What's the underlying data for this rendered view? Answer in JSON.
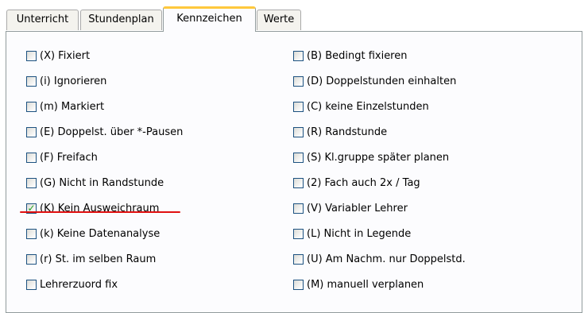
{
  "tabs": [
    {
      "label": "Unterricht",
      "active": false
    },
    {
      "label": "Stundenplan",
      "active": false
    },
    {
      "label": "Kennzeichen",
      "active": true
    },
    {
      "label": "Werte",
      "active": false
    }
  ],
  "left_options": [
    {
      "label": "(X) Fixiert",
      "checked": false
    },
    {
      "label": "(i) Ignorieren",
      "checked": false
    },
    {
      "label": "(m) Markiert",
      "checked": false
    },
    {
      "label": "(E) Doppelst. über *-Pausen",
      "checked": false
    },
    {
      "label": "(F) Freifach",
      "checked": false
    },
    {
      "label": "(G) Nicht in Randstunde",
      "checked": false
    },
    {
      "label": "(K) Kein Ausweichraum",
      "checked": true
    },
    {
      "label": "(k) Keine Datenanalyse",
      "checked": false
    },
    {
      "label": "(r) St. im selben Raum",
      "checked": false
    },
    {
      "label": "Lehrerzuord fix",
      "checked": false
    }
  ],
  "right_options": [
    {
      "label": "(B) Bedingt fixieren",
      "checked": false
    },
    {
      "label": "(D) Doppelstunden einhalten",
      "checked": false
    },
    {
      "label": "(C) keine Einzelstunden",
      "checked": false
    },
    {
      "label": "(R) Randstunde",
      "checked": false
    },
    {
      "label": "(S) Kl.gruppe später planen",
      "checked": false
    },
    {
      "label": "(2) Fach auch 2x / Tag",
      "checked": false
    },
    {
      "label": "(V) Variabler Lehrer",
      "checked": false
    },
    {
      "label": "(L) Nicht in Legende",
      "checked": false
    },
    {
      "label": "(U) Am Nachm. nur Doppelstd.",
      "checked": false
    },
    {
      "label": "(M) manuell verplanen",
      "checked": false
    }
  ],
  "colors": {
    "active_tab_accent": "#ffc83c",
    "checkmark": "#21a121",
    "highlight_underline": "#e01010",
    "checkbox_border": "#1c5180"
  }
}
